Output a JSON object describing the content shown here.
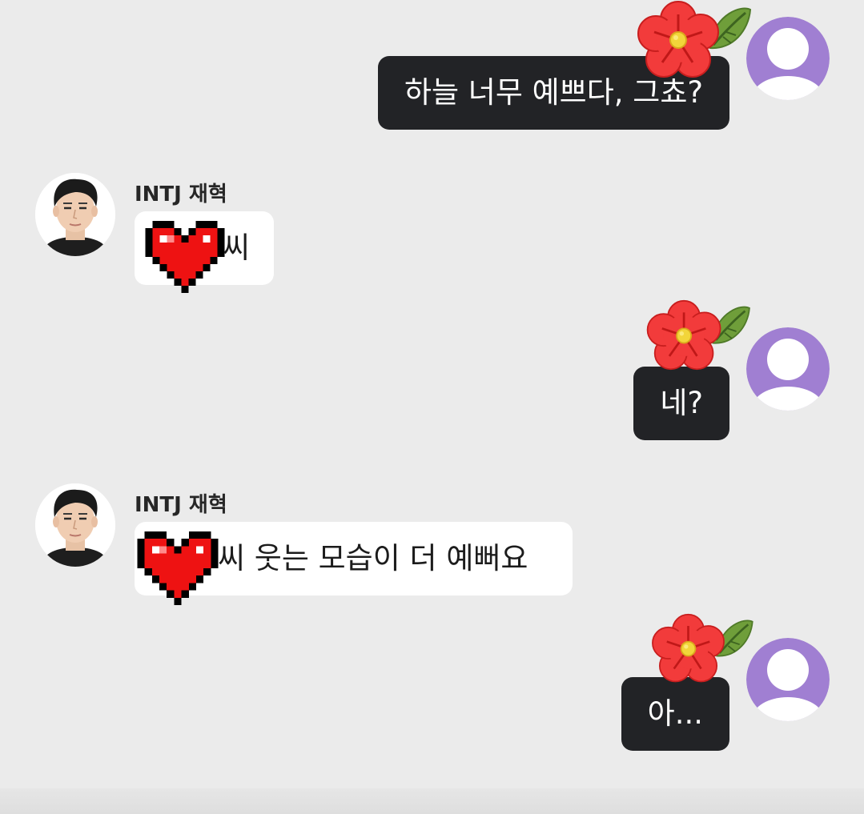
{
  "messages": [
    {
      "type": "sent",
      "text": "하늘 너무 예쁘다, 그쵸?"
    },
    {
      "type": "received",
      "sender": "INTJ 재혁",
      "text": "씨"
    },
    {
      "type": "sent",
      "text": "네?"
    },
    {
      "type": "received",
      "sender": "INTJ 재혁",
      "text": "씨 웃는 모습이 더 예뻐요"
    },
    {
      "type": "sent",
      "text": "아..."
    }
  ],
  "icons": {
    "sent_avatar": "default-user-avatar-icon",
    "sent_decoration": "red-flower-sticker-icon",
    "received_avatar": "profile-photo",
    "name_mask": "pixel-heart-icon"
  },
  "colors": {
    "background": "#ebebeb",
    "sent_bubble": "#222326",
    "sent_text": "#ffffff",
    "received_bubble": "#ffffff",
    "received_text": "#1c1c1c",
    "avatar_purple": "#a07fd2",
    "heart_red": "#ee1212",
    "flower_red": "#f23b3b",
    "leaf_green": "#6f9e3a"
  }
}
